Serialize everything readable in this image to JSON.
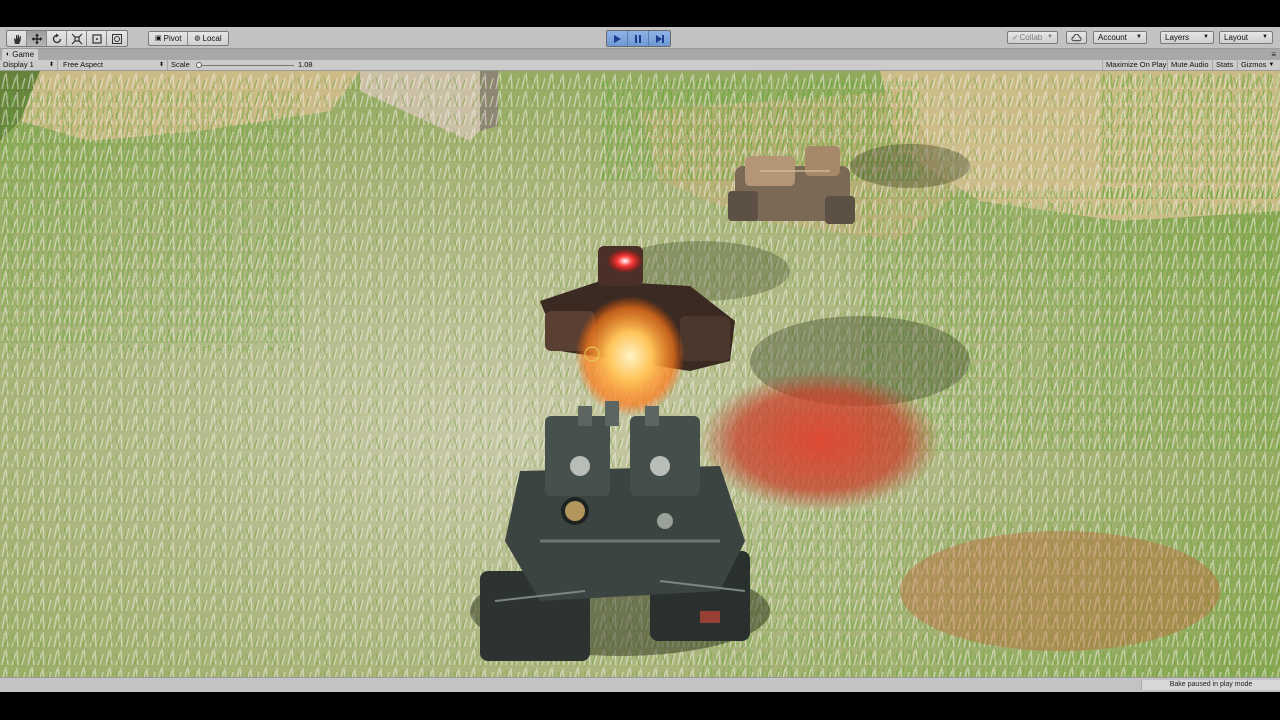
{
  "toolbar": {
    "tools": [
      {
        "name": "hand-tool",
        "icon": "hand-icon"
      },
      {
        "name": "move-tool",
        "icon": "move-arrows-icon"
      },
      {
        "name": "rotate-tool",
        "icon": "rotate-icon"
      },
      {
        "name": "scale-tool",
        "icon": "scale-icon"
      },
      {
        "name": "rect-tool",
        "icon": "rect-icon"
      },
      {
        "name": "transform-tool",
        "icon": "transform-icon"
      }
    ],
    "pivot_label": "Pivot",
    "local_label": "Local",
    "play_controls": [
      "play-icon",
      "pause-icon",
      "step-icon"
    ],
    "collab_label": "Collab",
    "account_label": "Account",
    "layers_label": "Layers",
    "layout_label": "Layout"
  },
  "game_tab": {
    "title": "Game"
  },
  "game_view": {
    "display": "Display 1",
    "aspect": "Free Aspect",
    "scale_label": "Scale",
    "scale_value": "1.08",
    "buttons": {
      "maximize": "Maximize On Play",
      "mute": "Mute Audio",
      "stats": "Stats",
      "gizmos": "Gizmos"
    }
  },
  "status": {
    "message": "Bake paused in play mode"
  },
  "colors": {
    "play_accent": "#7aa2dc",
    "editor_gray": "#c2c2c2",
    "grass_green": "#7fb04a",
    "explosion": "#ffb347",
    "red_patch": "#d9392a"
  }
}
